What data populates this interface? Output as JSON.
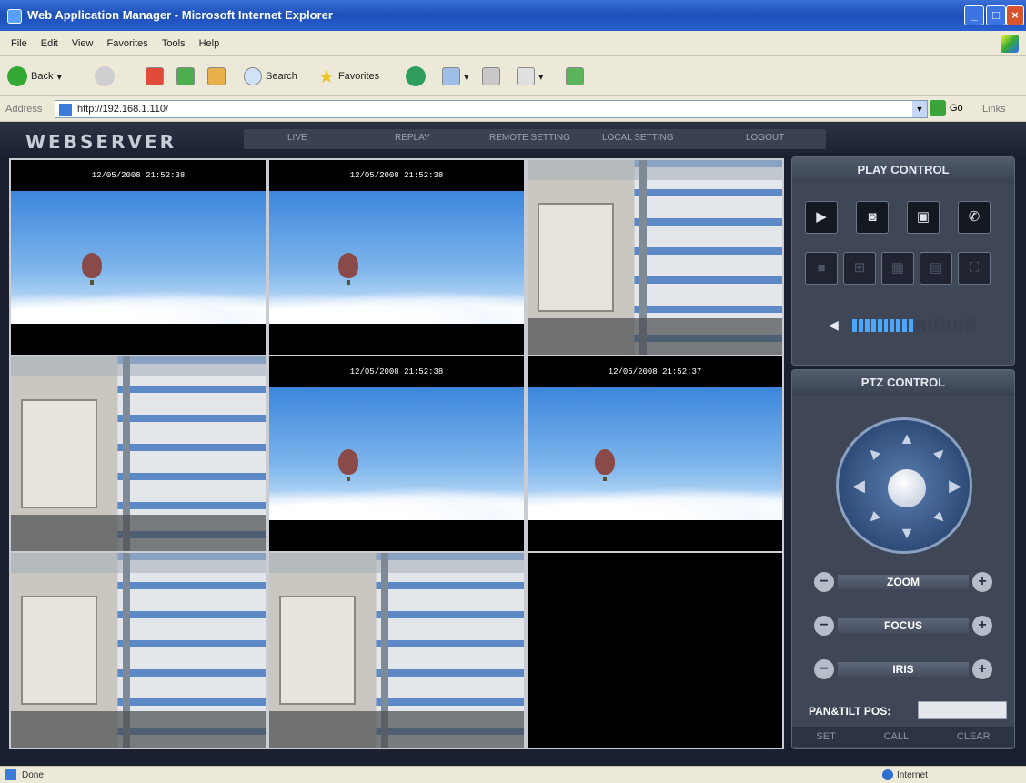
{
  "window": {
    "title": "Web Application Manager - Microsoft Internet Explorer"
  },
  "menu": [
    "File",
    "Edit",
    "View",
    "Favorites",
    "Tools",
    "Help"
  ],
  "toolbar": {
    "back_label": "Back",
    "search_label": "Search",
    "favorites_label": "Favorites"
  },
  "address": {
    "label": "Address",
    "url": "http://192.168.1.110/",
    "go_label": "Go",
    "links_label": "Links"
  },
  "app": {
    "logo": "WEBSERVER",
    "nav": [
      "LIVE",
      "REPLAY",
      "REMOTE SETTING",
      "LOCAL SETTING",
      "LOGOUT"
    ]
  },
  "channels": [
    {
      "type": "sky",
      "timestamp": "12/05/2008 21:52:38"
    },
    {
      "type": "sky",
      "timestamp": "12/05/2008 21:52:38"
    },
    {
      "type": "warehouse",
      "timestamp": ""
    },
    {
      "type": "warehouse",
      "timestamp": ""
    },
    {
      "type": "sky",
      "timestamp": "12/05/2008 21:52:38"
    },
    {
      "type": "sky",
      "timestamp": "12/05/2008 21:52:37"
    },
    {
      "type": "warehouse",
      "timestamp": ""
    },
    {
      "type": "warehouse",
      "timestamp": ""
    },
    {
      "type": "empty",
      "timestamp": ""
    }
  ],
  "play_control": {
    "title": "PLAY CONTROL",
    "volume_level": 0.5
  },
  "ptz_control": {
    "title": "PTZ CONTROL",
    "zoom_label": "ZOOM",
    "focus_label": "FOCUS",
    "iris_label": "IRIS",
    "pos_label": "PAN&TILT POS:",
    "pos_value": "",
    "set_label": "SET",
    "call_label": "CALL",
    "clear_label": "CLEAR"
  },
  "status": {
    "left": "Done",
    "zone": "Internet"
  },
  "colors": {
    "accent": "#4aa6ff",
    "panel": "#3f4757"
  }
}
